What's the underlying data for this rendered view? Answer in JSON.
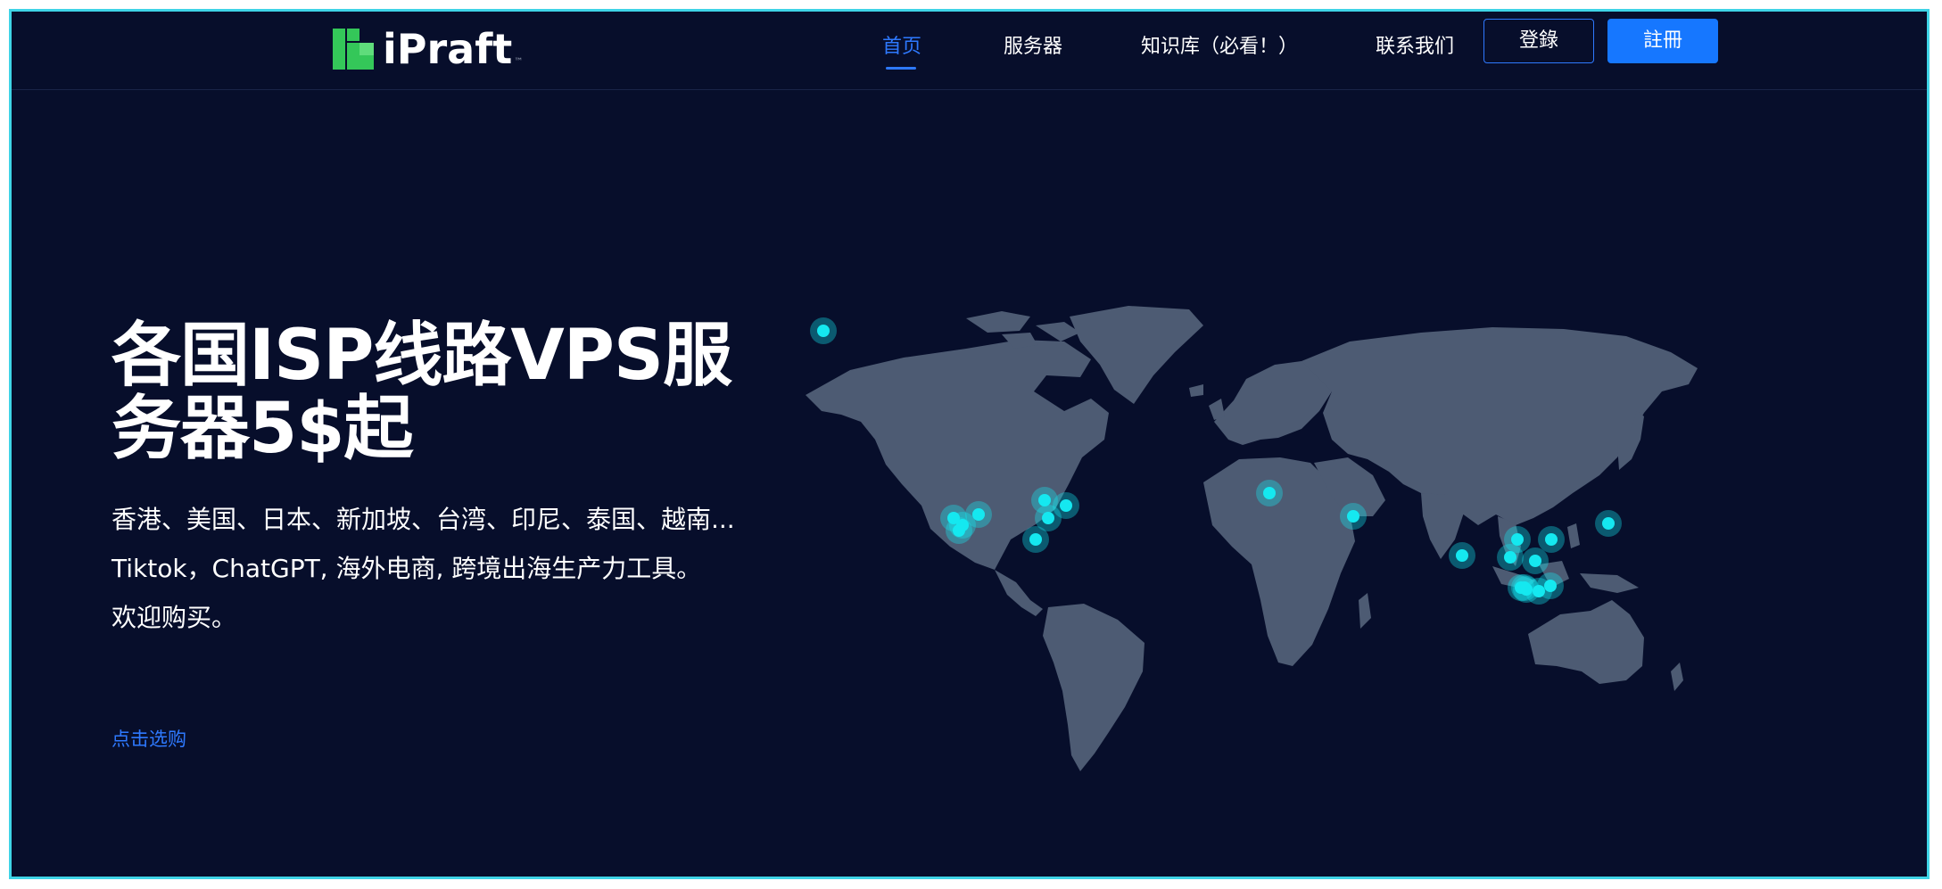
{
  "brand": {
    "name": "iPraft",
    "tm": "™"
  },
  "nav": {
    "items": [
      {
        "label": "首页",
        "active": true
      },
      {
        "label": "服务器"
      },
      {
        "label": "知识库（必看！）"
      },
      {
        "label": "联系我们"
      }
    ],
    "login_label": "登錄",
    "register_label": "註冊"
  },
  "hero": {
    "title": "各国ISP线路VPS服务器5$起",
    "line1": "香港、美国、日本、新加坡、台湾、印尼、泰国、越南...",
    "line2": "Tiktok，ChatGPT, 海外电商, 跨境出海生产力工具。",
    "line3": "欢迎购买。",
    "cta": "点击选购"
  },
  "colors": {
    "background": "#070e2b",
    "accent": "#2e79ff",
    "map_land": "#4d5b73",
    "marker": "#15e8f0",
    "logo_green": "#34c759"
  },
  "map": {
    "marker_icon": "location-dot-icon",
    "marker_count": 22
  }
}
